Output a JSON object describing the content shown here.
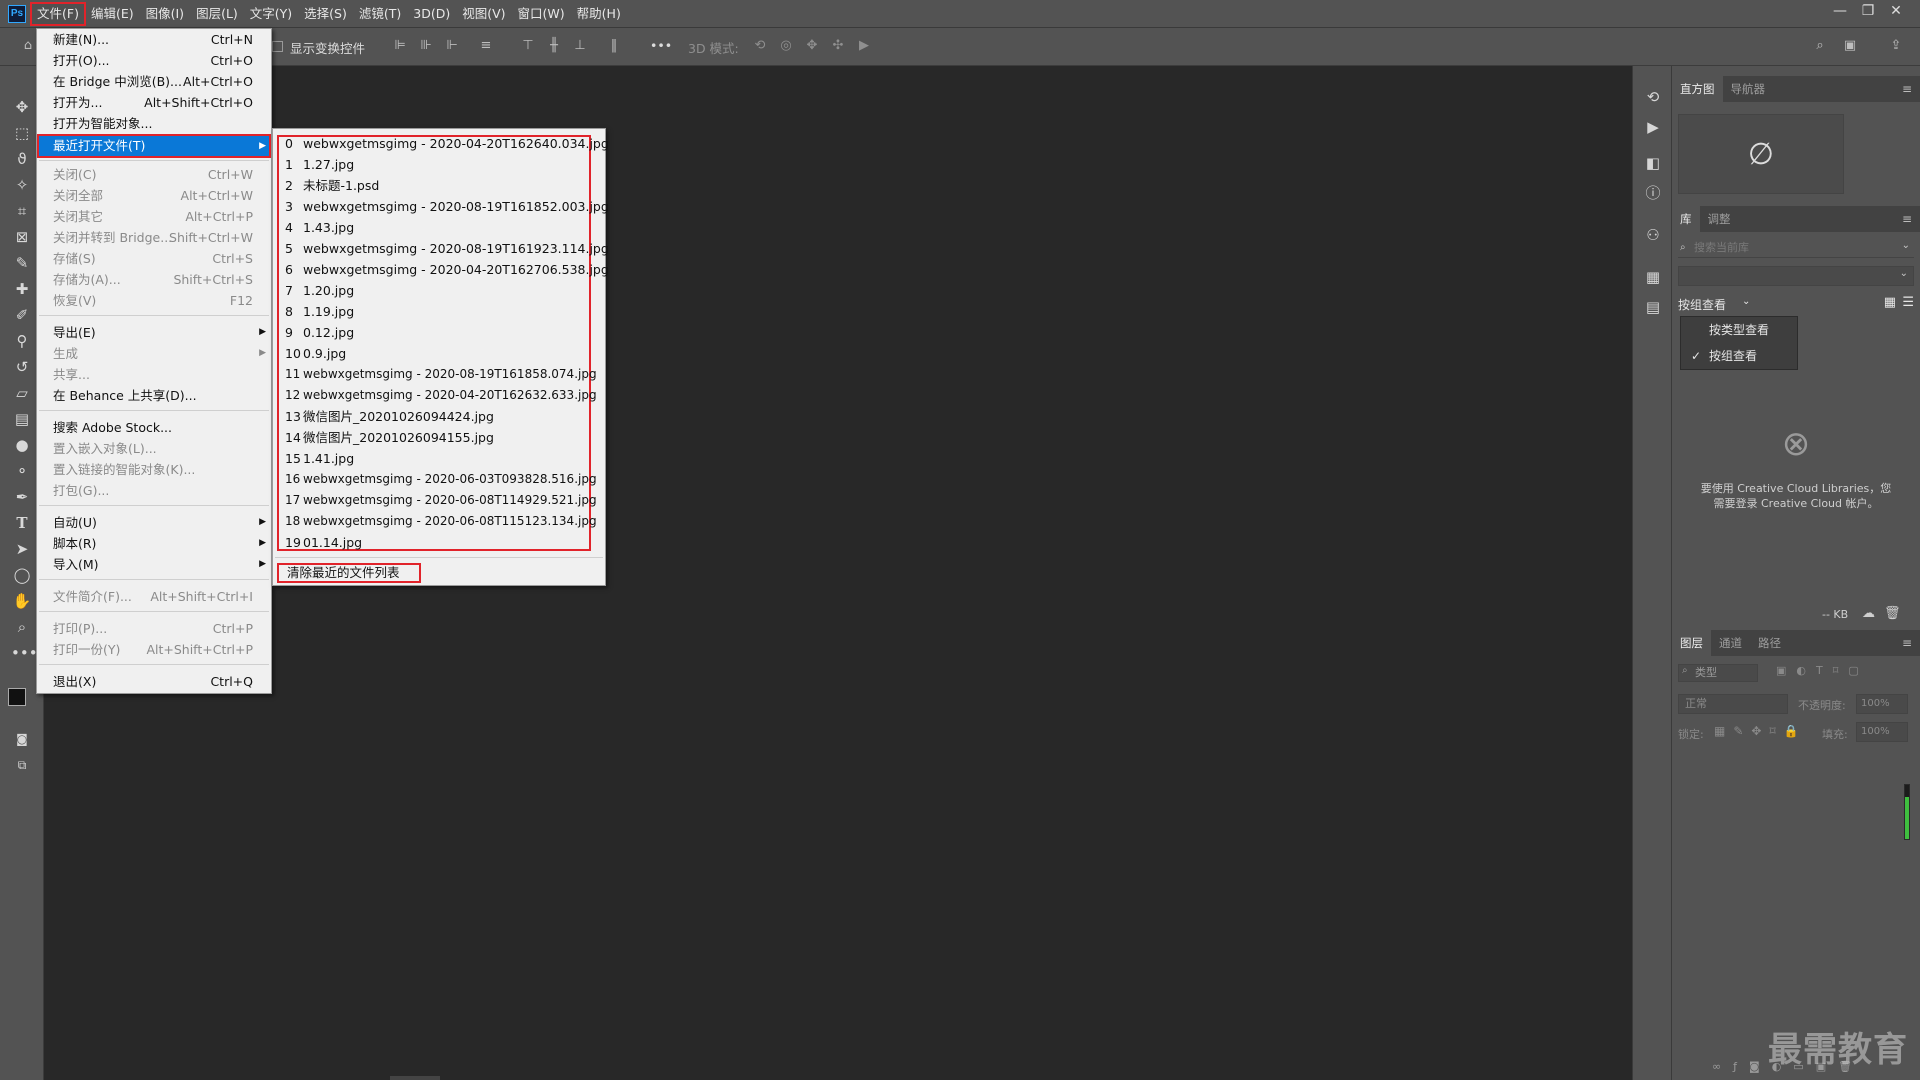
{
  "menubar": {
    "logo": "Ps",
    "items": [
      "文件(F)",
      "编辑(E)",
      "图像(I)",
      "图层(L)",
      "文字(Y)",
      "选择(S)",
      "滤镜(T)",
      "3D(D)",
      "视图(V)",
      "窗口(W)",
      "帮助(H)"
    ],
    "window_controls": [
      "—",
      "❐",
      "✕"
    ]
  },
  "options_bar": {
    "show_transform": "显示变换控件",
    "more": "•••",
    "mode_3d": "3D 模式:"
  },
  "file_menu": {
    "items": [
      {
        "label": "新建(N)...",
        "shortcut": "Ctrl+N"
      },
      {
        "label": "打开(O)...",
        "shortcut": "Ctrl+O"
      },
      {
        "label": "在 Bridge 中浏览(B)...",
        "shortcut": "Alt+Ctrl+O"
      },
      {
        "label": "打开为...",
        "shortcut": "Alt+Shift+Ctrl+O"
      },
      {
        "label": "打开为智能对象...",
        "shortcut": ""
      },
      {
        "label": "最近打开文件(T)",
        "shortcut": ""
      },
      {
        "label": "关闭(C)",
        "shortcut": "Ctrl+W"
      },
      {
        "label": "关闭全部",
        "shortcut": "Alt+Ctrl+W"
      },
      {
        "label": "关闭其它",
        "shortcut": "Alt+Ctrl+P"
      },
      {
        "label": "关闭并转到 Bridge...",
        "shortcut": "Shift+Ctrl+W"
      },
      {
        "label": "存储(S)",
        "shortcut": "Ctrl+S"
      },
      {
        "label": "存储为(A)...",
        "shortcut": "Shift+Ctrl+S"
      },
      {
        "label": "恢复(V)",
        "shortcut": "F12"
      },
      {
        "label": "导出(E)",
        "shortcut": ""
      },
      {
        "label": "生成",
        "shortcut": ""
      },
      {
        "label": "共享...",
        "shortcut": ""
      },
      {
        "label": "在 Behance 上共享(D)...",
        "shortcut": ""
      },
      {
        "label": "搜索 Adobe Stock...",
        "shortcut": ""
      },
      {
        "label": "置入嵌入对象(L)...",
        "shortcut": ""
      },
      {
        "label": "置入链接的智能对象(K)...",
        "shortcut": ""
      },
      {
        "label": "打包(G)...",
        "shortcut": ""
      },
      {
        "label": "自动(U)",
        "shortcut": ""
      },
      {
        "label": "脚本(R)",
        "shortcut": ""
      },
      {
        "label": "导入(M)",
        "shortcut": ""
      },
      {
        "label": "文件简介(F)...",
        "shortcut": "Alt+Shift+Ctrl+I"
      },
      {
        "label": "打印(P)...",
        "shortcut": "Ctrl+P"
      },
      {
        "label": "打印一份(Y)",
        "shortcut": "Alt+Shift+Ctrl+P"
      },
      {
        "label": "退出(X)",
        "shortcut": "Ctrl+Q"
      }
    ]
  },
  "recent_files": {
    "items": [
      {
        "idx": "0",
        "name": "webwxgetmsgimg - 2020-04-20T162640.034.jpg"
      },
      {
        "idx": "1",
        "name": "1.27.jpg"
      },
      {
        "idx": "2",
        "name": "未标题-1.psd"
      },
      {
        "idx": "3",
        "name": "webwxgetmsgimg - 2020-08-19T161852.003.jpg"
      },
      {
        "idx": "4",
        "name": "1.43.jpg"
      },
      {
        "idx": "5",
        "name": "webwxgetmsgimg - 2020-08-19T161923.114.jpg"
      },
      {
        "idx": "6",
        "name": "webwxgetmsgimg - 2020-04-20T162706.538.jpg"
      },
      {
        "idx": "7",
        "name": "1.20.jpg"
      },
      {
        "idx": "8",
        "name": "1.19.jpg"
      },
      {
        "idx": "9",
        "name": "0.12.jpg"
      },
      {
        "idx": "10",
        "name": "0.9.jpg"
      },
      {
        "idx": "11",
        "name": "webwxgetmsgimg - 2020-08-19T161858.074.jpg"
      },
      {
        "idx": "12",
        "name": "webwxgetmsgimg - 2020-04-20T162632.633.jpg"
      },
      {
        "idx": "13",
        "name": "微信图片_20201026094424.jpg"
      },
      {
        "idx": "14",
        "name": "微信图片_20201026094155.jpg"
      },
      {
        "idx": "15",
        "name": "1.41.jpg"
      },
      {
        "idx": "16",
        "name": "webwxgetmsgimg - 2020-06-03T093828.516.jpg"
      },
      {
        "idx": "17",
        "name": "webwxgetmsgimg - 2020-06-08T114929.521.jpg"
      },
      {
        "idx": "18",
        "name": "webwxgetmsgimg - 2020-06-08T115123.134.jpg"
      },
      {
        "idx": "19",
        "name": "01.14.jpg"
      }
    ],
    "clear_label": "清除最近的文件列表"
  },
  "panels": {
    "histogram_tabs": [
      "直方图",
      "导航器"
    ],
    "library_tabs": [
      "库",
      "调整"
    ],
    "search_placeholder": "搜索当前库",
    "view_by": "按组查看",
    "view_options": [
      "按类型查看",
      "按组查看"
    ],
    "cc_message_1": "要使用 Creative Cloud Libraries，您",
    "cc_message_2": "需要登录 Creative Cloud 帐户。",
    "kb": "-- KB",
    "layer_tabs": [
      "图层",
      "通道",
      "路径"
    ],
    "kind_label": "类型",
    "blend_mode": "正常",
    "opacity_label": "不透明度:",
    "opacity_value": "100%",
    "lock_label": "锁定:",
    "fill_label": "填充:",
    "fill_value": "100%"
  },
  "watermark": "最需教育",
  "colors": {
    "menu_highlight": "#0a78d7",
    "annotation_red": "#e1232a",
    "ui_gray": "#535353",
    "canvas": "#282828"
  }
}
